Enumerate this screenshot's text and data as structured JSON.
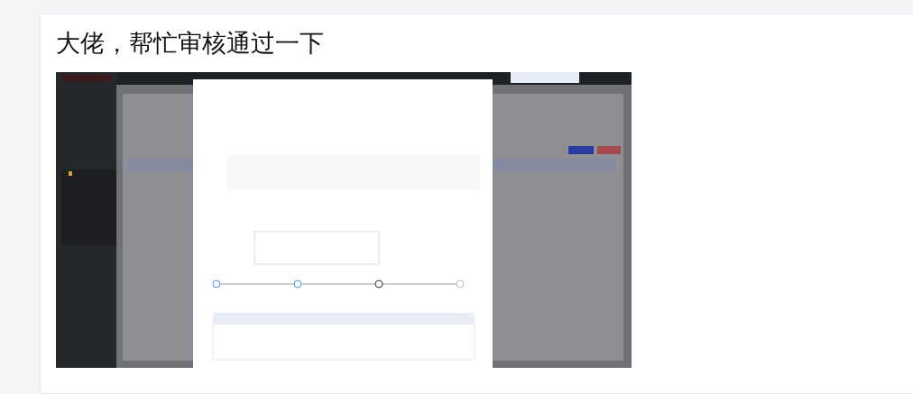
{
  "post": {
    "title": "大佬，帮忙审核通过一下"
  }
}
